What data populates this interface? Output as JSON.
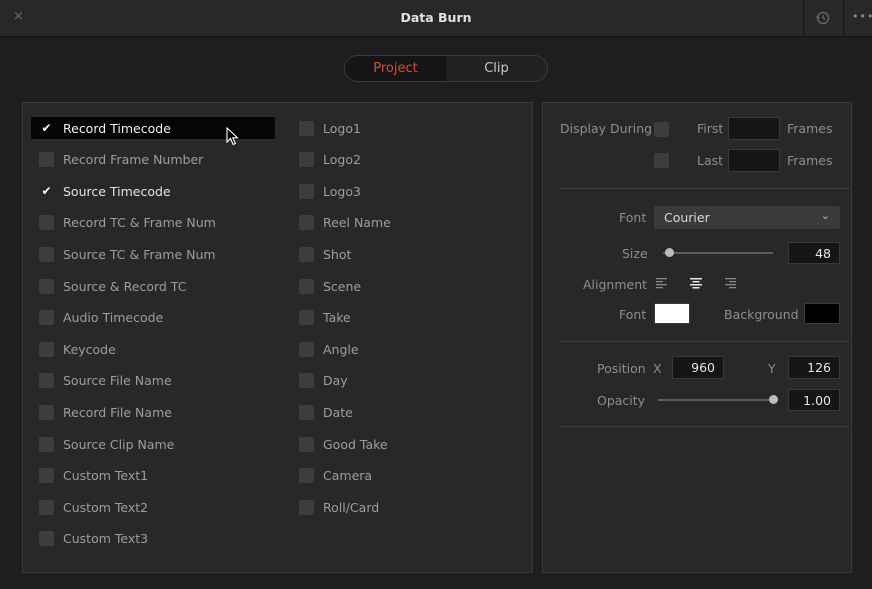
{
  "window": {
    "title": "Data Burn",
    "more_label": "•••",
    "close_label": "×"
  },
  "tabs": [
    {
      "label": "Project",
      "active": true
    },
    {
      "label": "Clip",
      "active": false
    }
  ],
  "left_column": [
    {
      "label": "Record Timecode",
      "checked": true,
      "highlighted": true
    },
    {
      "label": "Record Frame Number",
      "checked": false
    },
    {
      "label": "Source Timecode",
      "checked": true
    },
    {
      "label": "Record TC & Frame Num",
      "checked": false
    },
    {
      "label": "Source TC & Frame Num",
      "checked": false
    },
    {
      "label": "Source & Record TC",
      "checked": false
    },
    {
      "label": "Audio Timecode",
      "checked": false
    },
    {
      "label": "Keycode",
      "checked": false
    },
    {
      "label": "Source File Name",
      "checked": false
    },
    {
      "label": "Record File Name",
      "checked": false
    },
    {
      "label": "Source Clip Name",
      "checked": false
    },
    {
      "label": "Custom Text1",
      "checked": false
    },
    {
      "label": "Custom Text2",
      "checked": false
    },
    {
      "label": "Custom Text3",
      "checked": false
    }
  ],
  "right_column": [
    {
      "label": "Logo1",
      "checked": false
    },
    {
      "label": "Logo2",
      "checked": false
    },
    {
      "label": "Logo3",
      "checked": false
    },
    {
      "label": "Reel Name",
      "checked": false
    },
    {
      "label": "Shot",
      "checked": false
    },
    {
      "label": "Scene",
      "checked": false
    },
    {
      "label": "Take",
      "checked": false
    },
    {
      "label": "Angle",
      "checked": false
    },
    {
      "label": "Day",
      "checked": false
    },
    {
      "label": "Date",
      "checked": false
    },
    {
      "label": "Good Take",
      "checked": false
    },
    {
      "label": "Camera",
      "checked": false
    },
    {
      "label": "Roll/Card",
      "checked": false
    }
  ],
  "check_glyph": "✔",
  "settings": {
    "display_during": {
      "label": "Display During",
      "first_label": "First",
      "last_label": "Last",
      "frames_label": "Frames",
      "first_value": "",
      "last_value": ""
    },
    "font": {
      "label": "Font",
      "value": "Courier"
    },
    "size": {
      "label": "Size",
      "value": "48",
      "slider_fraction": 0.05
    },
    "alignment": {
      "label": "Alignment",
      "options": [
        "left-align-icon",
        "center-align-icon",
        "right-align-icon"
      ],
      "selected": "center"
    },
    "colors": {
      "font_label": "Font",
      "background_label": "Background",
      "font_color": "#ffffff",
      "background_color": "#000000"
    },
    "position": {
      "label": "Position",
      "x_label": "X",
      "x_value": "960",
      "y_label": "Y",
      "y_value": "126"
    },
    "opacity": {
      "label": "Opacity",
      "value": "1.00",
      "slider_fraction": 1.0
    }
  },
  "colors": {
    "accent": "#e2482d",
    "panel": "#28282a",
    "background": "#1e1e20"
  }
}
